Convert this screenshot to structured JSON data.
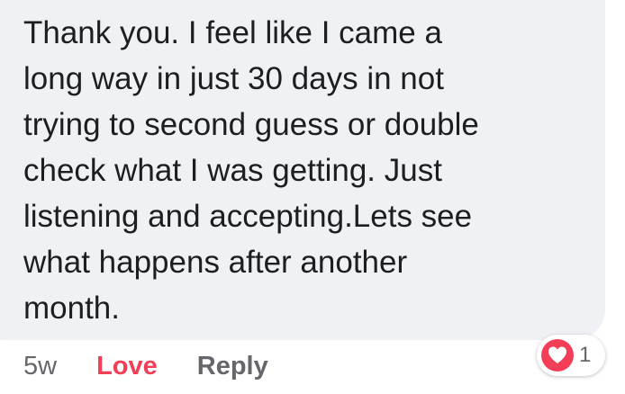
{
  "comment": {
    "text": "Thank you. I feel like  I came a\nlong way in just 30 days in not\ntrying to second guess or double\ncheck what I was getting. Just\nlistening and accepting.Lets see\nwhat happens after another\nmonth."
  },
  "actions": {
    "timestamp": "5w",
    "love_label": "Love",
    "reply_label": "Reply"
  },
  "reaction": {
    "icon": "heart-icon",
    "count": "1",
    "color": "#f33e58"
  },
  "colors": {
    "bubble": "#eff1f4",
    "text": "#1c1e21",
    "muted": "#65676b",
    "love": "#f33e58"
  }
}
